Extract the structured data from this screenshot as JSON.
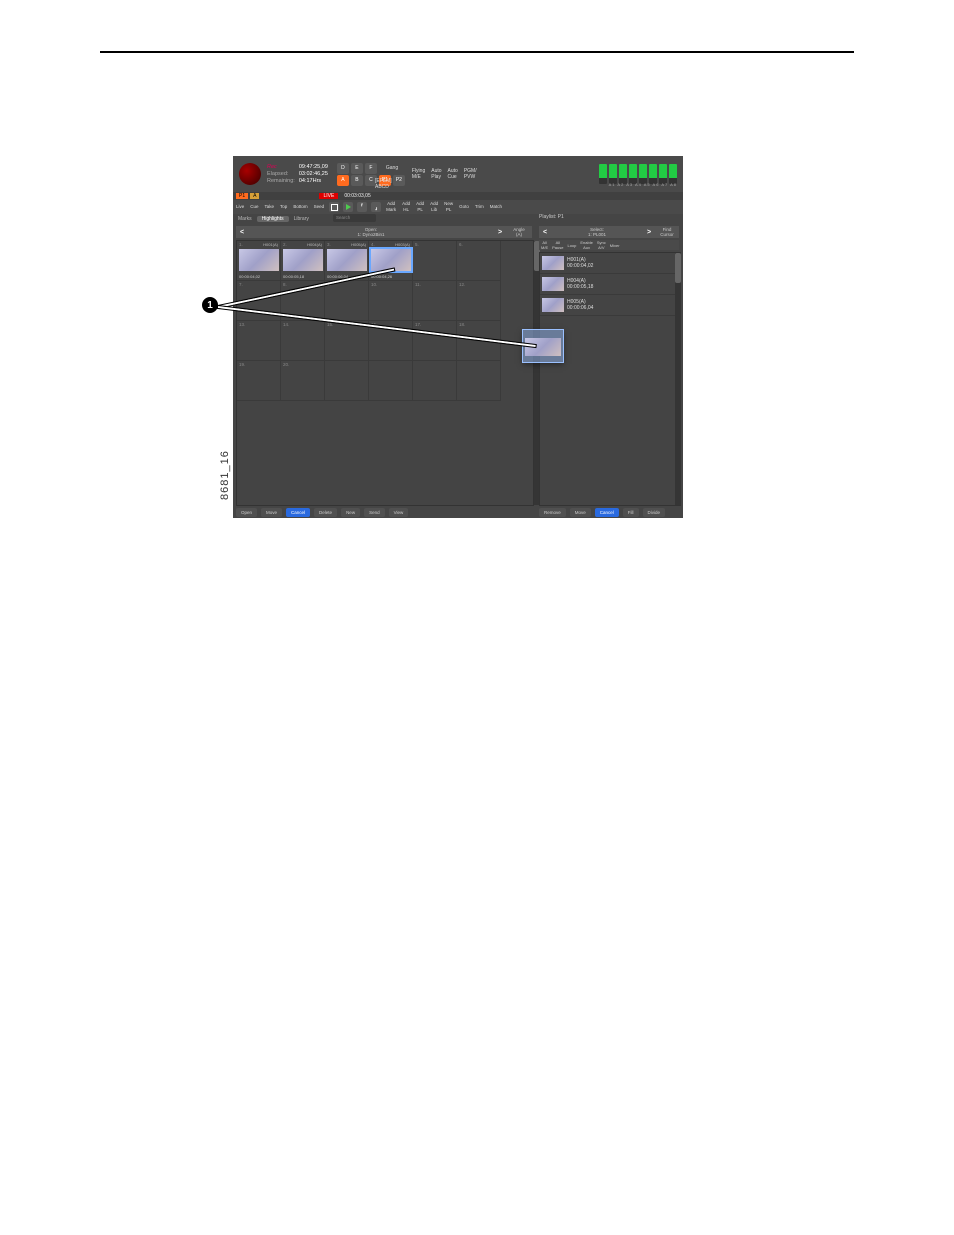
{
  "figure_label": "8681_16",
  "callout": "1",
  "timecodes": {
    "labels": {
      "rec": "Rec",
      "elapsed": "Elapsed:",
      "remaining": "Remaining:"
    },
    "rec": "09:47:25,09",
    "elapsed": "03:02:46,25",
    "remaining": "04:17Hrs"
  },
  "cams_row1": [
    "D",
    "E",
    "F"
  ],
  "cams_row2": [
    "A",
    "B",
    "C",
    "P1",
    "P2"
  ],
  "gang": "Gang",
  "switches": {
    "col1a": "Flying",
    "col1b": "M/E",
    "col2a": "Auto",
    "col2b": "Play",
    "col3a": "Auto",
    "col3b": "Cue",
    "col4a": "PGM/",
    "col4b": "PVW",
    "efem1": "[EFEM]",
    "efem2": "ABCD"
  },
  "meter_labels": "A1 A2 A3 A4 A5 A6 A7 A8",
  "status": {
    "p1": "P1",
    "a": "A",
    "live": "LIVE",
    "tc": "00:03:03,05"
  },
  "toolbar": {
    "live": "Live",
    "cue": "Cue",
    "take": "Take",
    "top": "Top",
    "bottom": "Bottom",
    "seed": "Seed",
    "addmark": "Add\nMark",
    "addhl": "Add\nHL",
    "addpl": "Add\nPL",
    "addlib": "Add\nLib",
    "newpl": "New\nPL",
    "goto": "Goto",
    "trim": "Trim",
    "match": "Match"
  },
  "tabs": {
    "marks": "Marks",
    "highlights": "Highlights",
    "library": "Library",
    "search": "Search"
  },
  "playlist_tab": "Playlist: P1",
  "hl_header": {
    "top": "Open:",
    "name": "1: Dyno2Bin1",
    "angle_top": "Angle",
    "angle_val": "(A)"
  },
  "clips": [
    {
      "idx": "1.",
      "name": "H001(A)",
      "tc": "00:00:04,02"
    },
    {
      "idx": "2.",
      "name": "H004(A)",
      "tc": "00:00:05,18"
    },
    {
      "idx": "3.",
      "name": "H005(A)",
      "tc": "00:00:06,04"
    },
    {
      "idx": "4.",
      "name": "H003(A)",
      "tc": "00:00:04,26"
    }
  ],
  "grid_idx": [
    "5.",
    "6.",
    "7.",
    "8.",
    "9.",
    "10.",
    "11.",
    "12.",
    "13.",
    "14.",
    "15.",
    "16.",
    "17.",
    "18.",
    "19.",
    "20."
  ],
  "pl_header": {
    "top": "Select:",
    "name": "1: PL001",
    "find_top": "Find",
    "find_bot": "Cursor"
  },
  "pl_opts": [
    "All\nM/E",
    "All\nPause",
    "Loop",
    "Enable\nAux",
    "Sync\nA/V",
    "Mixer"
  ],
  "pl_items": [
    {
      "name": "H001(A)",
      "tc": "00:00:04,02"
    },
    {
      "name": "H004(A)",
      "tc": "00:00:05,18"
    },
    {
      "name": "H005(A)",
      "tc": "00:00:06,04"
    }
  ],
  "act1": {
    "open": "Open",
    "move": "Move",
    "cancel": "Cancel",
    "delete": "Delete",
    "new": "New",
    "send": "Send",
    "view": "View"
  },
  "act2": {
    "remove": "Remove",
    "move": "Move",
    "cancel": "Cancel",
    "fill": "Fill",
    "divide": "Divide"
  }
}
